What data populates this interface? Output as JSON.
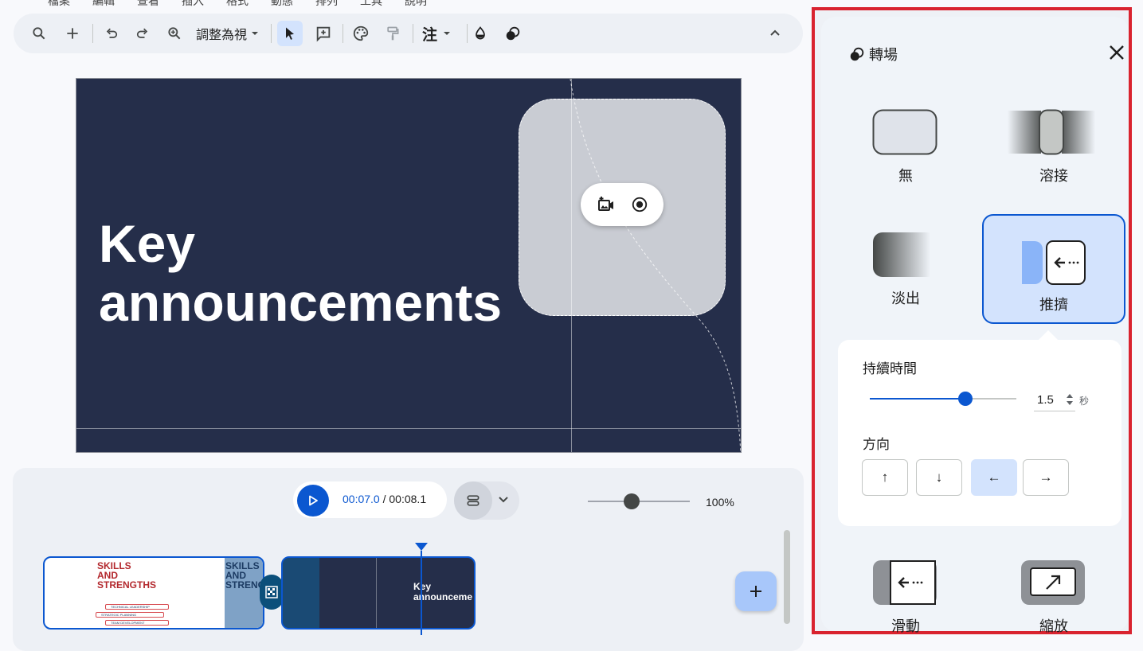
{
  "menu": {
    "items": [
      "檔案",
      "編輯",
      "查看",
      "插入",
      "格式",
      "動態",
      "排列",
      "工具",
      "說明"
    ]
  },
  "toolbar": {
    "zoom_label": "調整為視",
    "text_style_label": "注"
  },
  "slide": {
    "title_line1": "Key",
    "title_line2": "announcements"
  },
  "timeline": {
    "current_time": "00:07.0",
    "separator": " / ",
    "total_time": "00:08.1",
    "zoom_percent": "100%",
    "zoom_level": 0.45,
    "clip1": {
      "title": "SKILLS\nAND\nSTRENGTHS",
      "side_title": "SKILLS\nAND\nSTRENG",
      "bullets": [
        "TECHNICAL LEADERSHIP",
        "STRATEGIC PLANNING",
        "TEAM DEVELOPMENT"
      ]
    },
    "clip2": {
      "title": "Key\nannounceme"
    }
  },
  "panel": {
    "title": "轉場",
    "transitions": [
      {
        "label": "無",
        "selected": false
      },
      {
        "label": "溶接",
        "selected": false
      },
      {
        "label": "淡出",
        "selected": false
      },
      {
        "label": "推擠",
        "selected": true
      },
      {
        "label": "滑動",
        "selected": false
      },
      {
        "label": "縮放",
        "selected": false
      }
    ],
    "duration_label": "持續時間",
    "duration_value": "1.5",
    "duration_unit": "秒",
    "duration_fraction": 0.65,
    "direction_label": "方向",
    "directions": [
      "↑",
      "↓",
      "←",
      "→"
    ],
    "selected_direction": "←"
  },
  "colors": {
    "accent": "#0b57d0",
    "slide_bg": "#252e4a",
    "highlight_border": "#d9232f",
    "selected_bg": "#d3e3fd"
  }
}
